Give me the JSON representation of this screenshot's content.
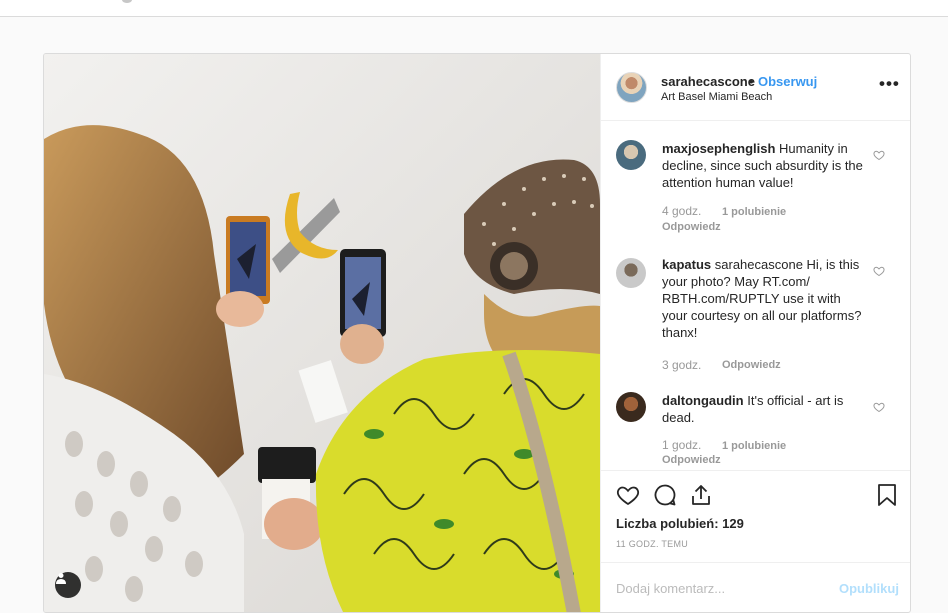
{
  "post": {
    "owner": "sarahecascone",
    "separator": "•",
    "follow_label": "Obserwuj",
    "location": "Art Basel Miami Beach",
    "more_label": "•••"
  },
  "comments": [
    {
      "user": "maxjosephenglish",
      "text": "Humanity in decline, since such absurdity is the attention human value!",
      "time": "4 godz.",
      "likes": "1 polubienie",
      "reply": "Odpowiedz"
    },
    {
      "user": "kapatus",
      "text": "sarahecascone Hi, is this your photo? May RT.com/ RBTH.com/RUPTLY use it with your courtesy on all our platforms? thanx!",
      "time": "3 godz.",
      "likes": "",
      "reply": "Odpowiedz"
    },
    {
      "user": "daltongaudin",
      "text": "It's official - art is dead.",
      "time": "1 godz.",
      "likes": "1 polubienie",
      "reply": "Odpowiedz"
    }
  ],
  "actions": {
    "likes_label": "Liczba polubień: 129",
    "timestamp": "11 GODZ. TEMU"
  },
  "composer": {
    "placeholder": "Dodaj komentarz...",
    "publish_label": "Opublikuj"
  },
  "icons": {
    "like": "heart-icon",
    "comment": "comment-icon",
    "share": "share-icon",
    "save": "bookmark-icon",
    "tag": "user-tag-icon",
    "options": "more-options-icon"
  },
  "colors": {
    "accent": "#3897f0",
    "publish_disabled": "#b2dffc",
    "muted": "#999999",
    "text": "#262626"
  }
}
